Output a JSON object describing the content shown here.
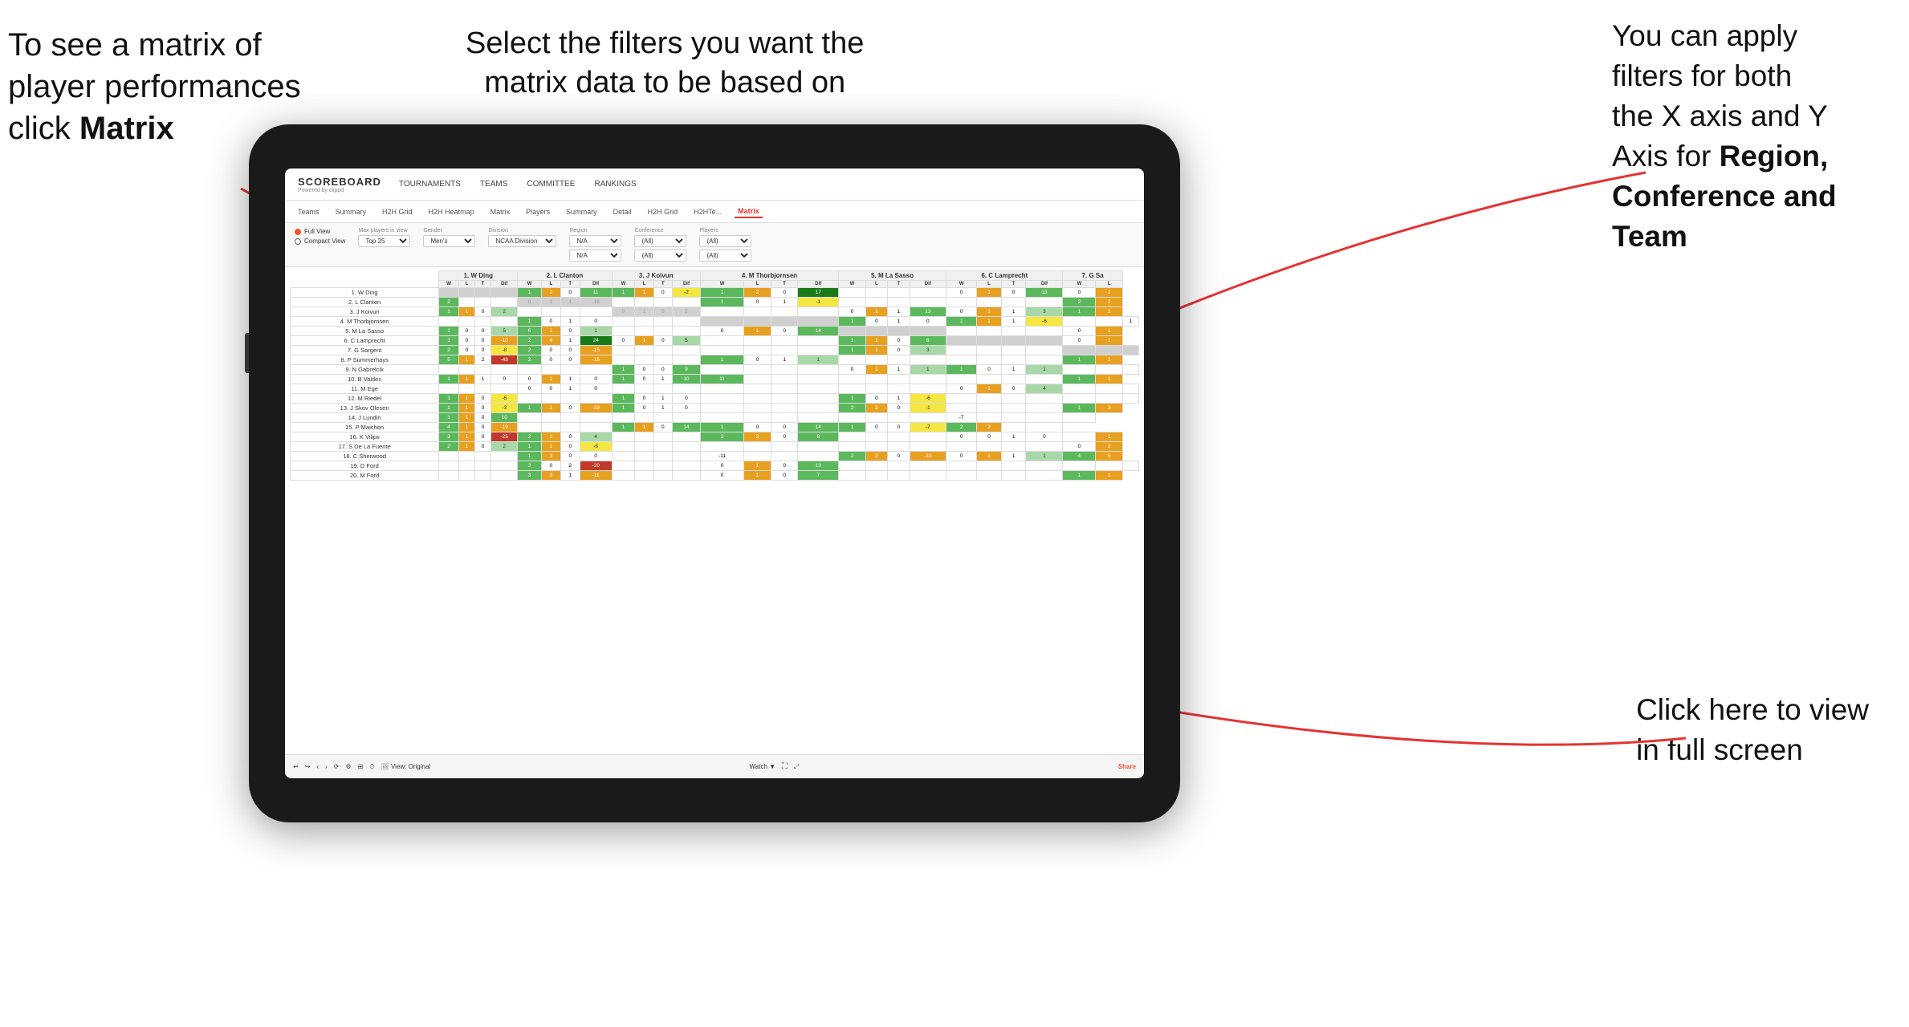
{
  "annotations": {
    "top_left": {
      "line1": "To see a matrix of",
      "line2": "player performances",
      "line3_prefix": "click ",
      "line3_bold": "Matrix"
    },
    "top_center": {
      "line1": "Select the filters you want the",
      "line2": "matrix data to be based on"
    },
    "top_right": {
      "line1": "You  can apply",
      "line2": "filters for both",
      "line3": "the X axis and Y",
      "line4_prefix": "Axis for ",
      "line4_bold": "Region,",
      "line5_bold": "Conference and",
      "line6_bold": "Team"
    },
    "bottom_right": {
      "line1": "Click here to view",
      "line2": "in full screen"
    }
  },
  "nav": {
    "logo": "SCOREBOARD",
    "logo_sub": "Powered by clippd",
    "links": [
      "TOURNAMENTS",
      "TEAMS",
      "COMMITTEE",
      "RANKINGS"
    ]
  },
  "sub_tabs": [
    "Teams",
    "Summary",
    "H2H Grid",
    "H2H Heatmap",
    "Matrix",
    "Players",
    "Summary",
    "Detail",
    "H2H Grid",
    "H2HTe...",
    "Matrix"
  ],
  "filters": {
    "view_full": "Full View",
    "view_compact": "Compact View",
    "max_players_label": "Max players in view",
    "max_players_value": "Top 25",
    "gender_label": "Gender",
    "gender_value": "Men's",
    "division_label": "Division",
    "division_value": "NCAA Division I",
    "region_label": "Region",
    "region_value1": "N/A",
    "region_value2": "N/A",
    "conference_label": "Conference",
    "conference_value1": "(All)",
    "conference_value2": "(All)",
    "players_label": "Players",
    "players_value1": "(All)",
    "players_value2": "(All)"
  },
  "matrix": {
    "col_headers": [
      "1. W Ding",
      "2. L Clanton",
      "3. J Koivun",
      "4. M Thorbjornsen",
      "5. M La Sasso",
      "6. C Lamprecht",
      "7. G Sa"
    ],
    "sub_headers": [
      "W",
      "L",
      "T",
      "Dif"
    ],
    "rows": [
      {
        "name": "1. W Ding",
        "cells": [
          "",
          "",
          "",
          "",
          "1",
          "2",
          "0",
          "11",
          "1",
          "1",
          "0",
          "-2",
          "1",
          "2",
          "0",
          "17",
          "",
          "",
          "",
          "",
          "0",
          "1",
          "0",
          "13",
          "0",
          "2"
        ]
      },
      {
        "name": "2. L Clanton",
        "cells": [
          "2",
          "",
          "",
          "",
          "0",
          "1",
          "1",
          "-18",
          "",
          "",
          "",
          "",
          "1",
          "0",
          "1",
          "-1",
          "",
          "",
          "",
          "",
          "",
          "",
          "",
          "",
          "2",
          "2"
        ]
      },
      {
        "name": "3. J Koivun",
        "cells": [
          "1",
          "1",
          "0",
          "2",
          "",
          "",
          "",
          "",
          "0",
          "1",
          "0",
          "2",
          "",
          "",
          "",
          "",
          "0",
          "1",
          "1",
          "13",
          "0",
          "1",
          "1",
          "3",
          "1",
          "2"
        ]
      },
      {
        "name": "4. M Thorbjornsen",
        "cells": [
          "",
          "",
          "",
          "",
          "1",
          "0",
          "1",
          "0",
          "",
          "",
          "",
          "",
          "",
          "",
          "",
          "",
          "1",
          "0",
          "1",
          "0",
          "1",
          "1",
          "1",
          "-6",
          "",
          "",
          "1"
        ]
      },
      {
        "name": "5. M La Sasso",
        "cells": [
          "1",
          "0",
          "0",
          "5",
          "6",
          "1",
          "0",
          "1",
          "",
          "",
          "",
          "",
          "0",
          "1",
          "0",
          "14",
          "",
          "",
          "",
          "",
          "",
          "",
          "",
          "",
          "0",
          "1"
        ]
      },
      {
        "name": "6. C Lamprecht",
        "cells": [
          "1",
          "0",
          "0",
          "-10",
          "2",
          "4",
          "1",
          "24",
          "0",
          "1",
          "0",
          "5",
          "",
          "",
          "",
          "",
          "1",
          "1",
          "0",
          "6",
          "",
          "",
          "",
          "",
          "0",
          "1"
        ]
      },
      {
        "name": "7. G Sargent",
        "cells": [
          "2",
          "0",
          "0",
          "-8",
          "2",
          "0",
          "0",
          "-15",
          "",
          "",
          "",
          "",
          "",
          "",
          "",
          "",
          "1",
          "1",
          "0",
          "3",
          "",
          "",
          "",
          "",
          "",
          "",
          ""
        ]
      },
      {
        "name": "8. P Summerhays",
        "cells": [
          "5",
          "1",
          "2",
          "-48",
          "2",
          "0",
          "0",
          "-16",
          "",
          "",
          "",
          "",
          "1",
          "0",
          "1",
          "1",
          "",
          "",
          "",
          "",
          "",
          "",
          "",
          "",
          "1",
          "2"
        ]
      },
      {
        "name": "9. N Gabrelcik",
        "cells": [
          "",
          "",
          "",
          "",
          "",
          "",
          "",
          "",
          "1",
          "0",
          "0",
          "9",
          "",
          "",
          "",
          "",
          "0",
          "1",
          "1",
          "1",
          "1",
          "0",
          "1",
          "1",
          "",
          "",
          ""
        ]
      },
      {
        "name": "10. B Valdes",
        "cells": [
          "1",
          "1",
          "1",
          "0",
          "0",
          "1",
          "1",
          "0",
          "1",
          "0",
          "1",
          "10",
          "11",
          "",
          "",
          "",
          "",
          "",
          "",
          "",
          "",
          "",
          "",
          "",
          "1",
          "1"
        ]
      },
      {
        "name": "11. M Ege",
        "cells": [
          "",
          "",
          "",
          "",
          "0",
          "0",
          "1",
          "0",
          "",
          "",
          "",
          "",
          "",
          "",
          "",
          "",
          "",
          "",
          "",
          "",
          "0",
          "1",
          "0",
          "4",
          "",
          "",
          ""
        ]
      },
      {
        "name": "12. M Riedel",
        "cells": [
          "1",
          "1",
          "0",
          "-6",
          "",
          "",
          "",
          "",
          "1",
          "0",
          "1",
          "0",
          "",
          "",
          "",
          "",
          "1",
          "0",
          "1",
          "-6",
          "",
          "",
          "",
          "",
          "",
          "",
          ""
        ]
      },
      {
        "name": "13. J Skov Olesen",
        "cells": [
          "1",
          "1",
          "0",
          "-3",
          "1",
          "1",
          "0",
          "-19",
          "1",
          "0",
          "1",
          "0",
          "",
          "",
          "",
          "",
          "2",
          "2",
          "0",
          "-1",
          "",
          "",
          "",
          "",
          "1",
          "3"
        ]
      },
      {
        "name": "14. J Lundin",
        "cells": [
          "1",
          "1",
          "0",
          "10",
          "",
          "",
          "",
          "",
          "",
          "",
          "",
          "",
          "",
          "",
          "",
          "",
          "",
          "",
          "",
          "",
          "-7",
          "",
          "",
          "",
          ""
        ]
      },
      {
        "name": "15. P Maichon",
        "cells": [
          "4",
          "1",
          "0",
          "-19",
          "",
          "",
          "",
          "",
          "1",
          "1",
          "0",
          "14",
          "1",
          "0",
          "0",
          "14",
          "1",
          "0",
          "0",
          "-7",
          "2",
          "2",
          "",
          ""
        ]
      },
      {
        "name": "16. K Vilips",
        "cells": [
          "3",
          "1",
          "0",
          "-25",
          "2",
          "2",
          "0",
          "4",
          "",
          "",
          "",
          "",
          "3",
          "3",
          "0",
          "8",
          "",
          "",
          "",
          "",
          "0",
          "0",
          "1",
          "0",
          "",
          "1"
        ]
      },
      {
        "name": "17. S De La Fuente",
        "cells": [
          "2",
          "1",
          "0",
          "2",
          "1",
          "1",
          "0",
          "-8",
          "",
          "",
          "",
          "",
          "",
          "",
          "",
          "",
          "",
          "",
          "",
          "",
          "",
          "",
          "",
          "",
          "0",
          "2"
        ]
      },
      {
        "name": "18. C Sherwood",
        "cells": [
          "",
          "",
          "",
          "",
          "1",
          "3",
          "0",
          "0",
          "",
          "",
          "",
          "",
          "-11",
          "",
          "",
          "",
          "2",
          "2",
          "0",
          "-10",
          "0",
          "1",
          "1",
          "1",
          "4",
          "5"
        ]
      },
      {
        "name": "19. D Ford",
        "cells": [
          "",
          "",
          "",
          "",
          "2",
          "0",
          "2",
          "-20",
          "",
          "",
          "",
          "",
          "0",
          "1",
          "0",
          "13",
          "",
          "",
          "",
          "",
          "",
          "",
          "",
          "",
          "",
          "",
          ""
        ]
      },
      {
        "name": "20. M Ford",
        "cells": [
          "",
          "",
          "",
          "",
          "3",
          "3",
          "1",
          "-11",
          "",
          "",
          "",
          "",
          "0",
          "1",
          "0",
          "7",
          "",
          "",
          "",
          "",
          "",
          "",
          "",
          "",
          "1",
          "1"
        ]
      }
    ]
  },
  "bottom_bar": {
    "view_label": "View: Original",
    "watch_label": "Watch",
    "share_label": "Share"
  },
  "colors": {
    "accent": "#e53333",
    "arrow_color": "#e53"
  }
}
